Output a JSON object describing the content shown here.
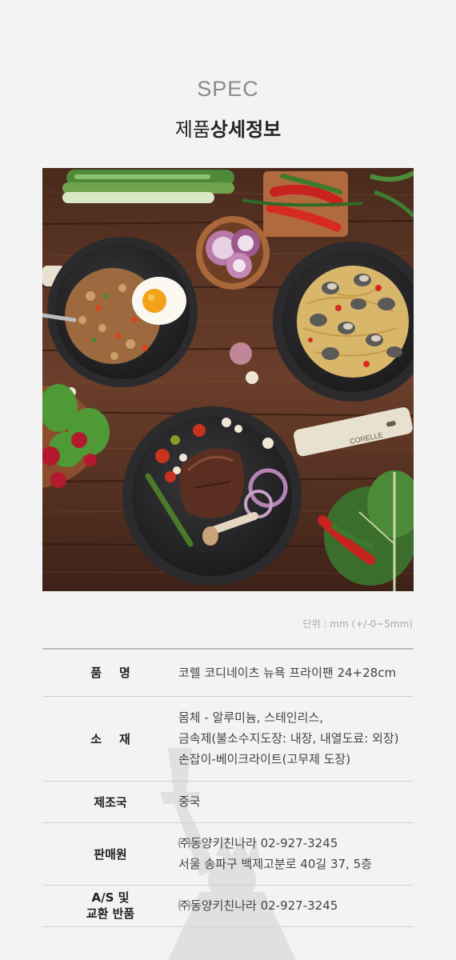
{
  "header": {
    "eyebrow": "SPEC",
    "title_light": "제품",
    "title_bold": "상세정보"
  },
  "photo": {
    "pan_brand": "CORELLE",
    "icon": "product-photo-cookware"
  },
  "unit_note": "단위 : mm (+/-0~5mm)",
  "spec_table": {
    "rows": [
      {
        "label": "품명",
        "values": [
          "코렐 코디네이츠 뉴욕 프라이팬 24+28cm"
        ]
      },
      {
        "label": "소재",
        "values": [
          "몸체 - 알루미늄, 스테인리스,",
          "금속제(불소수지도장: 내장, 내열도료: 외장)",
          "손잡이-베이크라이트(고무제 도장)"
        ]
      },
      {
        "label": "제조국",
        "values": [
          "중국"
        ]
      },
      {
        "label": "판매원",
        "values": [
          "㈜동양키친나라 02-927-3245",
          "서울 송파구 백제고분로 40길 37, 5층"
        ]
      },
      {
        "label_lines": [
          "A/S 및",
          "교환 반품"
        ],
        "values": [
          "㈜동양키친나라 02-927-3245"
        ]
      }
    ]
  },
  "colors": {
    "background": "#f3f3f3",
    "wood": "#5a3424",
    "pan": "#2b2b2d",
    "handle_cream": "#e8e1cf"
  }
}
